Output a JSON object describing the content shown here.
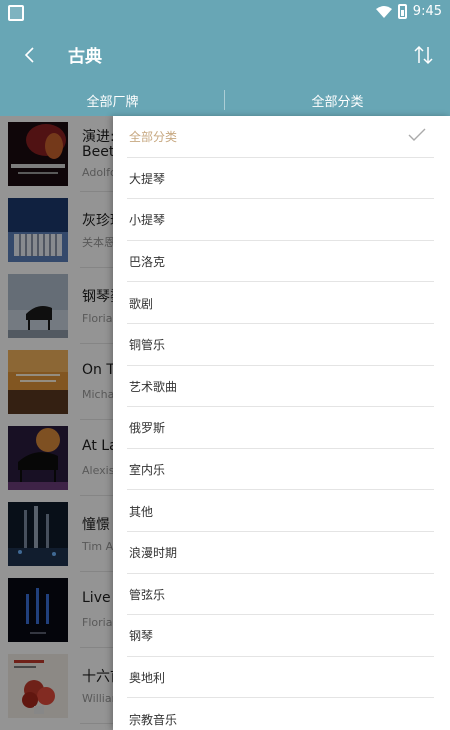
{
  "status_bar": {
    "time": "9:45"
  },
  "header": {
    "title": "古典"
  },
  "filters": {
    "brand_label": "全部厂牌",
    "category_label": "全部分类"
  },
  "albums": [
    {
      "title": "演进:",
      "title2": "Beeth",
      "artist": "Adolfo"
    },
    {
      "title": "灰珍珠",
      "artist": "关本恩"
    },
    {
      "title": "钢琴鎏",
      "artist": "Florian"
    },
    {
      "title": "On Th",
      "artist": "Michae"
    },
    {
      "title": "At La",
      "artist": "Alexis"
    },
    {
      "title": "憧憬 (",
      "artist": "Tim Al"
    },
    {
      "title": "Live (",
      "artist": "Florian"
    },
    {
      "title": "十六首",
      "artist": "William"
    }
  ],
  "category_menu": {
    "selected_index": 0,
    "items": [
      "全部分类",
      "大提琴",
      "小提琴",
      "巴洛克",
      "歌剧",
      "铜管乐",
      "艺术歌曲",
      "俄罗斯",
      "室内乐",
      "其他",
      "浪漫时期",
      "管弦乐",
      "钢琴",
      "奥地利",
      "宗教音乐"
    ]
  },
  "colors": {
    "accent": "#68a6b5",
    "selected_text": "#c7a881"
  }
}
